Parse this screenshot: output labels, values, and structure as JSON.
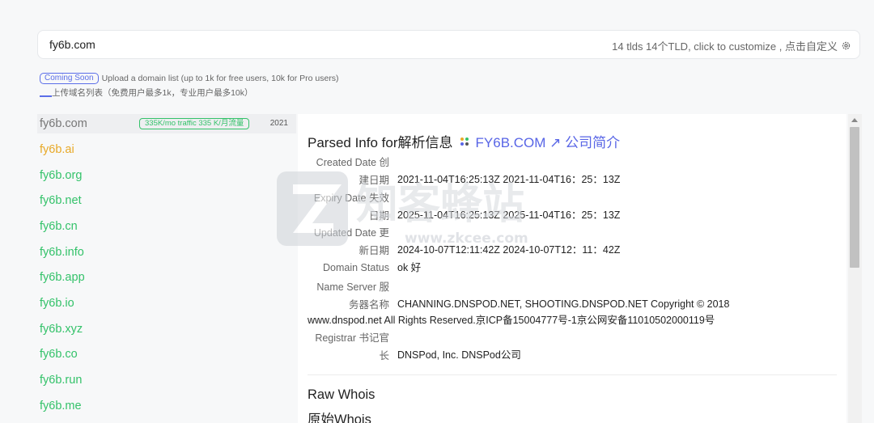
{
  "search": {
    "value": "fy6b.com",
    "tld_hint": "14 tlds 14个TLD, click to customize ,  点击自定义"
  },
  "upload": {
    "badge": "Coming Soon",
    "text_en": "Upload a domain list (up to 1k for free users, 10k for Pro users)",
    "text_cn": "上传域名列表（免费用户最多1k，专业用户最多10k）"
  },
  "domains": [
    {
      "name": "fy6b.com"
    },
    {
      "name": "fy6b.ai"
    },
    {
      "name": "fy6b.org"
    },
    {
      "name": "fy6b.net"
    },
    {
      "name": "fy6b.cn"
    },
    {
      "name": "fy6b.info"
    },
    {
      "name": "fy6b.app"
    },
    {
      "name": "fy6b.io"
    },
    {
      "name": "fy6b.xyz"
    },
    {
      "name": "fy6b.co"
    },
    {
      "name": "fy6b.run"
    },
    {
      "name": "fy6b.me"
    }
  ],
  "selected": {
    "traffic": "335K/mo traffic  335 K/月流量",
    "year": "2021"
  },
  "panel": {
    "title": "Parsed Info for解析信息",
    "domain": "FY6B.COM ↗ 公司简介",
    "rows": [
      {
        "label": "Created Date 创建日期",
        "value": "2021-11-04T16:25:13Z  2021-11-04T16：25：13Z"
      },
      {
        "label": "Expiry Date 失效日期",
        "value": "2025-11-04T16:25:13Z  2025-11-04T16：25：13Z"
      },
      {
        "label": "Updated Date 更新日期",
        "value": "2024-10-07T12:11:42Z  2024-10-07T12：11：42Z"
      },
      {
        "label": "Domain Status",
        "value": "ok  好"
      },
      {
        "label": "Name Server 服务器名称",
        "value": "CHANNING.DNSPOD.NET, SHOOTING.DNSPOD.NET  Copyright © 2018",
        "value2": "www.dnspod.net All Rights Reserved.京ICP备15004777号-1京公网安备11010502000119号"
      },
      {
        "label": "Registrar 书记官长",
        "value": "DNSPod, Inc.  DNSPod公司"
      }
    ],
    "raw_title": "Raw Whois",
    "raw_title_cn": "原始Whois"
  },
  "watermark": {
    "text": "知客蜂站",
    "url": "www.zkcee.com"
  }
}
